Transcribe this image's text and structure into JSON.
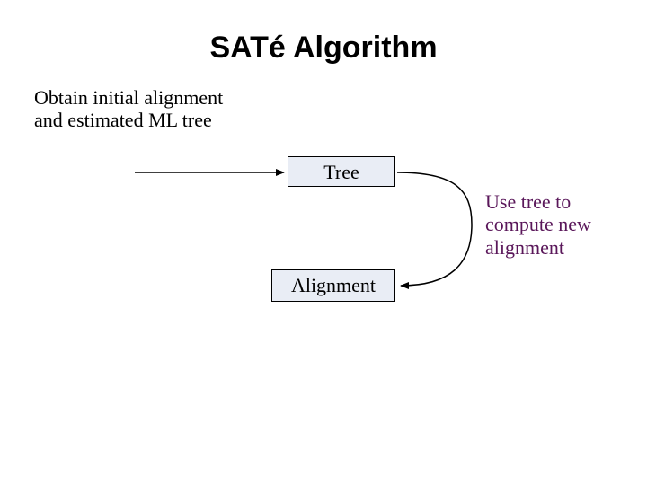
{
  "title": "SATé Algorithm",
  "step_initial": "Obtain initial alignment\nand estimated ML tree",
  "node_tree": "Tree",
  "node_alignment": "Alignment",
  "use_tree_text": "Use tree to\ncompute new\nalignment",
  "colors": {
    "accent_text": "#5a175a",
    "node_fill": "#e9edf5"
  }
}
